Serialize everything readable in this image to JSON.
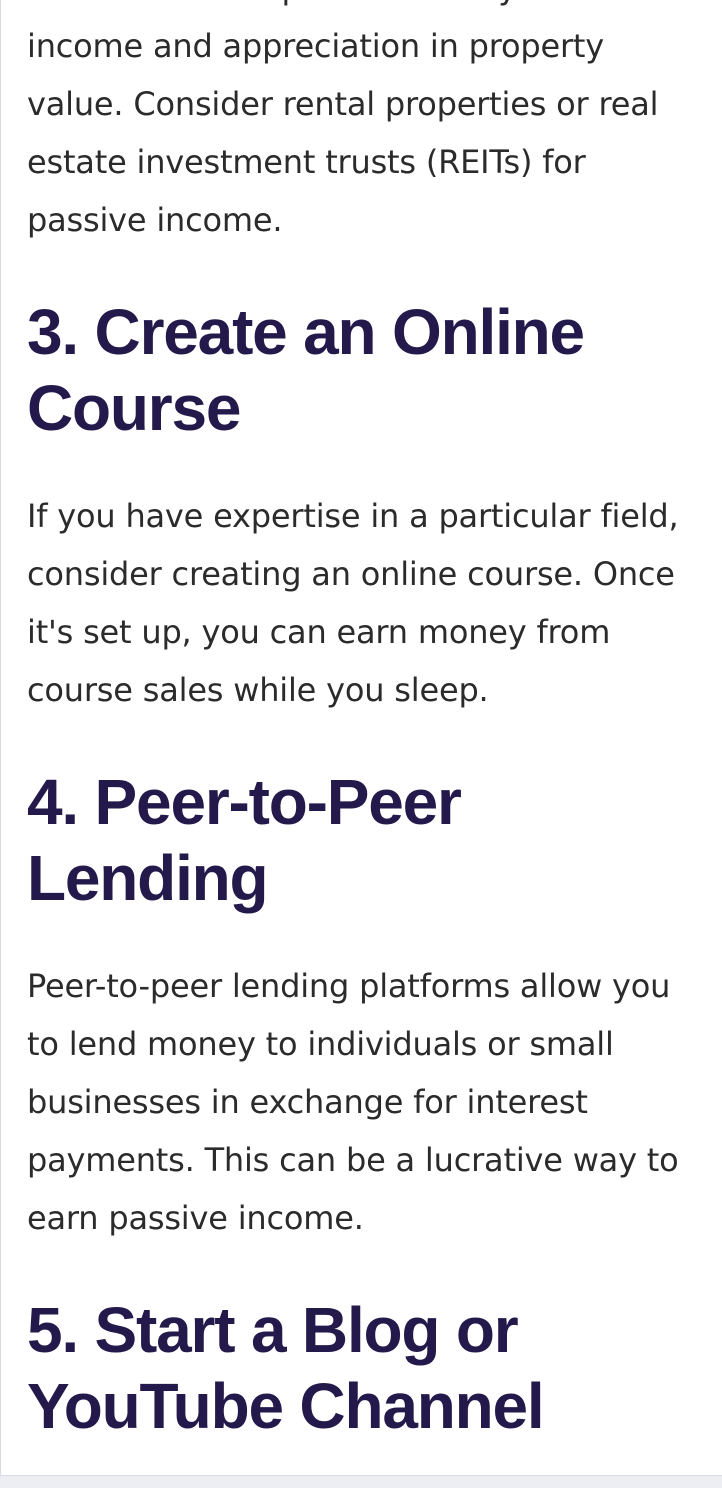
{
  "article": {
    "intro_paragraph": "Real estate can provide steady rental income and appreciation in property value. Consider rental properties or real estate investment trusts (REITs) for passive income.",
    "sections": [
      {
        "heading": "3. Create an Online Course",
        "body": "If you have expertise in a particular field, consider creating an online course. Once it's set up, you can earn money from course sales while you sleep."
      },
      {
        "heading": "4. Peer-to-Peer Lending",
        "body": "Peer-to-peer lending platforms allow you to lend money to individuals or small businesses in exchange for interest payments. This can be a lucrative way to earn passive income."
      },
      {
        "heading": "5. Start a Blog or YouTube Channel"
      }
    ]
  }
}
